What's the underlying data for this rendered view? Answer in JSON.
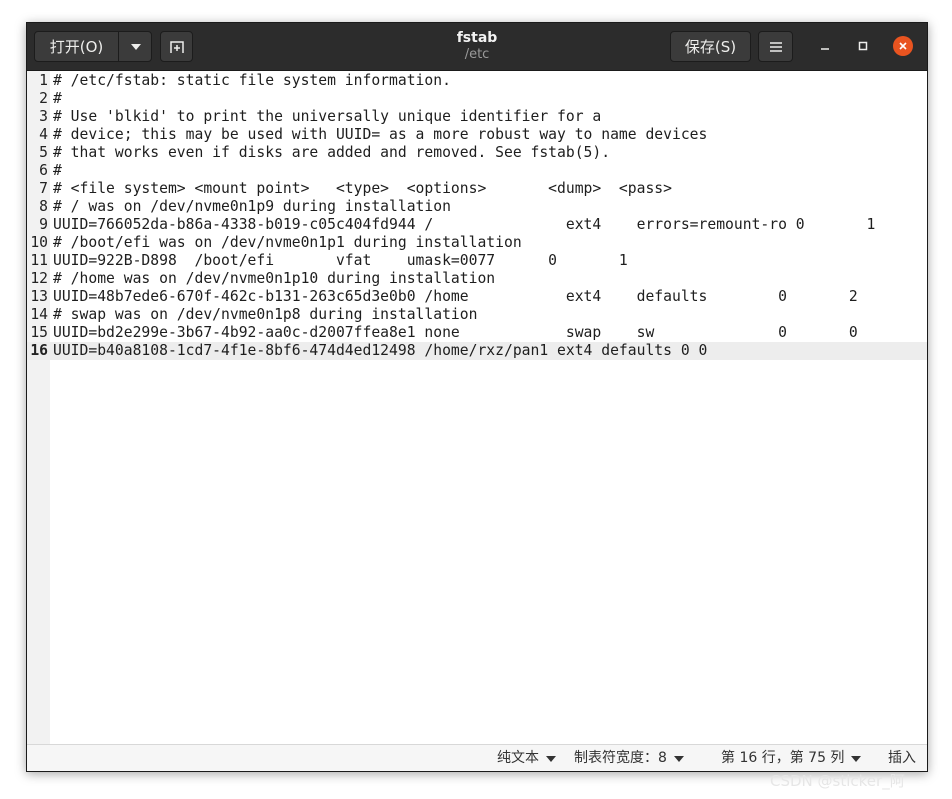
{
  "window": {
    "title": "fstab",
    "subtitle": "/etc"
  },
  "toolbar": {
    "open_label": "打开(O)",
    "save_label": "保存(S)"
  },
  "editor": {
    "current_line": 16,
    "lines": [
      {
        "n": "1",
        "text": "# /etc/fstab: static file system information."
      },
      {
        "n": "2",
        "text": "#"
      },
      {
        "n": "3",
        "text": "# Use 'blkid' to print the universally unique identifier for a"
      },
      {
        "n": "4",
        "text": "# device; this may be used with UUID= as a more robust way to name devices"
      },
      {
        "n": "5",
        "text": "# that works even if disks are added and removed. See fstab(5)."
      },
      {
        "n": "6",
        "text": "#"
      },
      {
        "n": "7",
        "text": "# <file system> <mount point>   <type>  <options>       <dump>  <pass>"
      },
      {
        "n": "8",
        "text": "# / was on /dev/nvme0n1p9 during installation"
      },
      {
        "n": "9",
        "text": "UUID=766052da-b86a-4338-b019-c05c404fd944 /               ext4    errors=remount-ro 0       1"
      },
      {
        "n": "10",
        "text": "# /boot/efi was on /dev/nvme0n1p1 during installation"
      },
      {
        "n": "11",
        "text": "UUID=922B-D898  /boot/efi       vfat    umask=0077      0       1"
      },
      {
        "n": "12",
        "text": "# /home was on /dev/nvme0n1p10 during installation"
      },
      {
        "n": "13",
        "text": "UUID=48b7ede6-670f-462c-b131-263c65d3e0b0 /home           ext4    defaults        0       2"
      },
      {
        "n": "14",
        "text": "# swap was on /dev/nvme0n1p8 during installation"
      },
      {
        "n": "15",
        "text": "UUID=bd2e299e-3b67-4b92-aa0c-d2007ffea8e1 none            swap    sw              0       0"
      },
      {
        "n": "16",
        "text": "UUID=b40a8108-1cd7-4f1e-8bf6-474d4ed12498 /home/rxz/pan1 ext4 defaults 0 0"
      }
    ]
  },
  "statusbar": {
    "language": "纯文本",
    "tab_width": "制表符宽度：8",
    "position": "第 16 行，第 75 列",
    "insert_mode": "插入"
  },
  "watermark": "CSDN @sticker_阿",
  "icons": {
    "open_dropdown": "chevron-down-icon",
    "new_tab": "new-tab-icon",
    "menu": "hamburger-menu-icon",
    "minimize": "minimize-icon",
    "maximize": "maximize-icon",
    "close": "close-icon"
  },
  "colors": {
    "headerbar": "#2c2c2c",
    "close_button": "#e95420",
    "current_line": "#ededed",
    "gutter": "#f2f2f2"
  }
}
